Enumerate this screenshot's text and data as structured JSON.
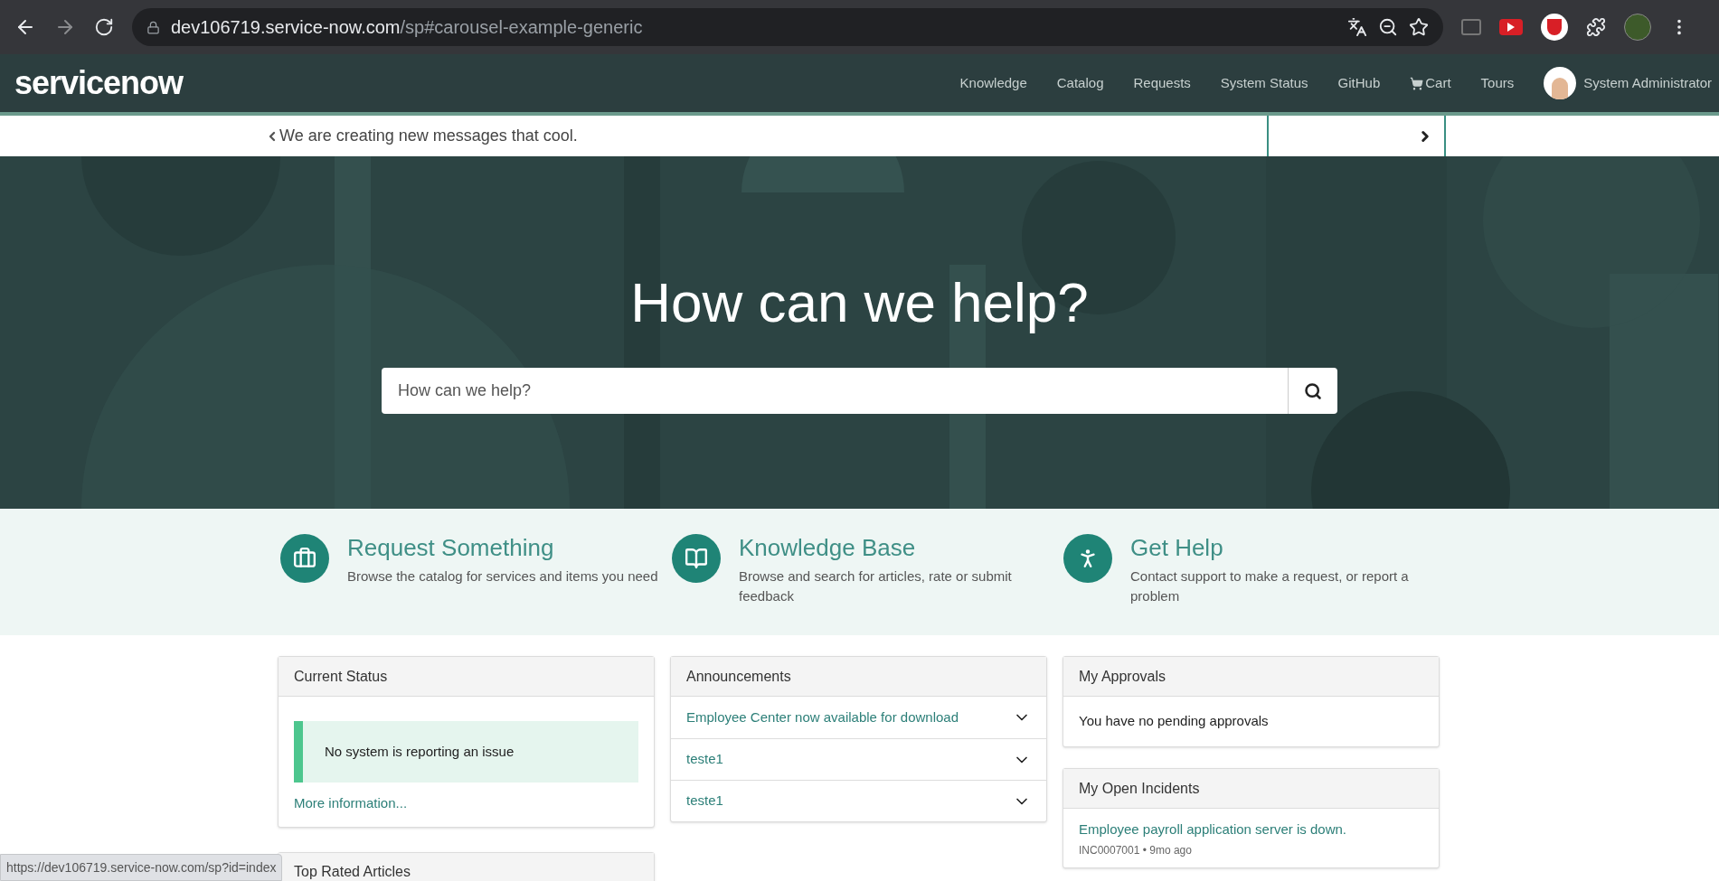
{
  "browser": {
    "url_host": "dev106719.service-now.com",
    "url_path": "/sp#carousel-example-generic",
    "status_url": "https://dev106719.service-now.com/sp?id=index"
  },
  "nav": {
    "logo": "servicenow",
    "items": [
      {
        "label": "Knowledge",
        "kind": "link"
      },
      {
        "label": "Catalog",
        "kind": "link"
      },
      {
        "label": "Requests",
        "kind": "link"
      },
      {
        "label": "System Status",
        "kind": "link"
      },
      {
        "label": "GitHub",
        "kind": "link"
      },
      {
        "label": "Cart",
        "kind": "cart"
      },
      {
        "label": "Tours",
        "kind": "link"
      }
    ],
    "user": "System Administrator"
  },
  "banner": {
    "message": "We are creating new messages that cool."
  },
  "hero": {
    "title": "How can we help?",
    "search_placeholder": "How can we help?"
  },
  "tiles": [
    {
      "kind": "briefcase",
      "title": "Request Something",
      "description": "Browse the catalog for services and items you need"
    },
    {
      "kind": "book",
      "title": "Knowledge Base",
      "description": "Browse and search for articles, rate or submit feedback"
    },
    {
      "kind": "person",
      "title": "Get Help",
      "description": "Contact support to make a request, or report a problem"
    }
  ],
  "current_status": {
    "title": "Current Status",
    "message": "No system is reporting an issue",
    "link": "More information..."
  },
  "top_rated": {
    "title": "Top Rated Articles"
  },
  "announcements": {
    "title": "Announcements",
    "items": [
      {
        "label": "Employee Center now available for download",
        "expanded": false
      },
      {
        "label": "teste1",
        "expanded": false
      },
      {
        "label": "teste1",
        "expanded": false
      }
    ]
  },
  "approvals": {
    "title": "My Approvals",
    "message": "You have no pending approvals"
  },
  "incidents": {
    "title": "My Open Incidents",
    "items": [
      {
        "title": "Employee payroll application server is down.",
        "meta": "INC0007001 • 9mo ago"
      }
    ]
  }
}
